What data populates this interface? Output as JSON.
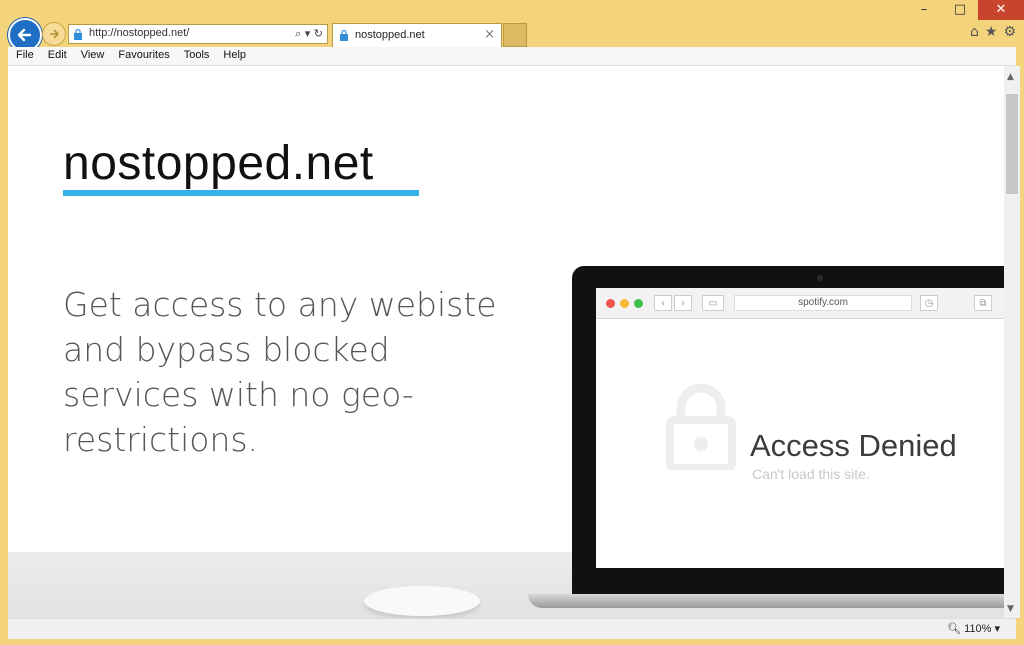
{
  "browser": {
    "address_url": "http://nostopped.net/",
    "address_actions": "⌕ ▾ ↻",
    "tab_title": "nostopped.net",
    "tab_close": "×",
    "window_minimize": "–",
    "window_maximize": "□",
    "window_close": "✕",
    "toolbar_icons": [
      "home-icon",
      "star-icon",
      "gear-icon"
    ],
    "menu": [
      "File",
      "Edit",
      "View",
      "Favourites",
      "Tools",
      "Help"
    ],
    "zoom": "110%"
  },
  "page": {
    "site_title": "nostopped.net",
    "headline_lines": [
      "Get access to any webiste",
      "and bypass blocked",
      "services with no geo-",
      "restrictions."
    ]
  },
  "mock_browser": {
    "url": "spotify.com",
    "heading": "Access Denied",
    "subheading": "Can't load this site."
  },
  "colors": {
    "frame": "#f3d37b",
    "accent_underline": "#35b3e8",
    "back_button": "#1e6fc3",
    "close_button": "#c8442c"
  }
}
